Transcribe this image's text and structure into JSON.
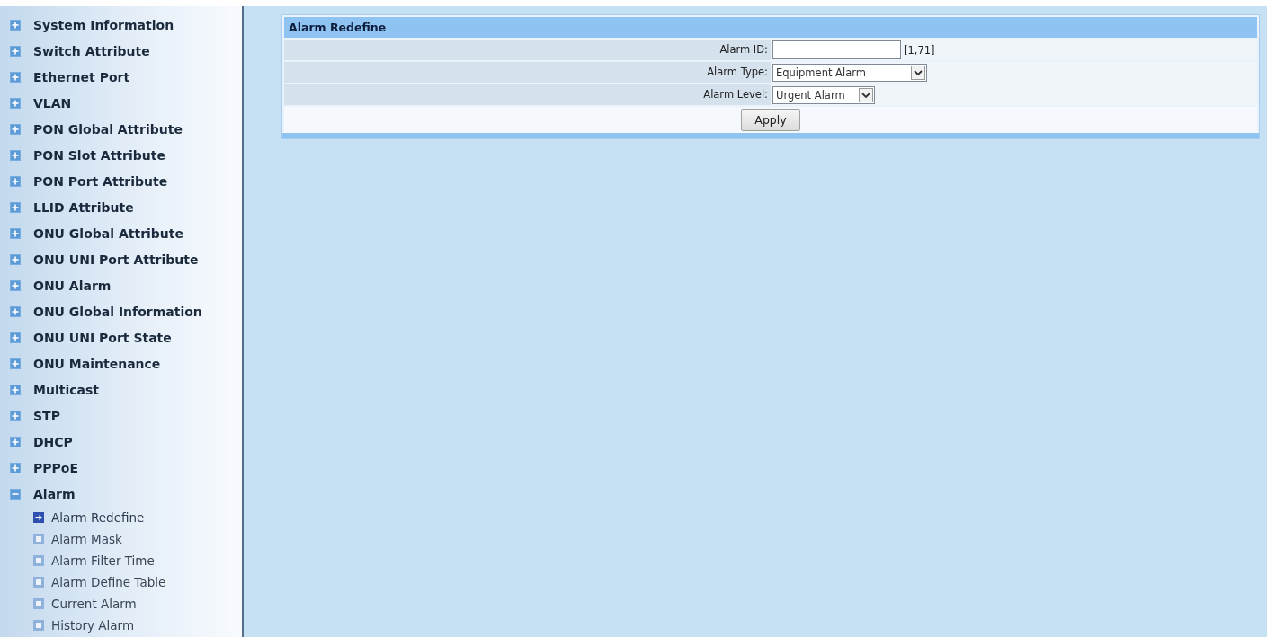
{
  "sidebar": {
    "items": [
      {
        "label": "System Information",
        "expanded": false
      },
      {
        "label": "Switch Attribute",
        "expanded": false
      },
      {
        "label": "Ethernet Port",
        "expanded": false
      },
      {
        "label": "VLAN",
        "expanded": false
      },
      {
        "label": "PON Global Attribute",
        "expanded": false
      },
      {
        "label": "PON Slot Attribute",
        "expanded": false
      },
      {
        "label": "PON Port Attribute",
        "expanded": false
      },
      {
        "label": "LLID Attribute",
        "expanded": false
      },
      {
        "label": "ONU Global Attribute",
        "expanded": false
      },
      {
        "label": "ONU UNI Port Attribute",
        "expanded": false
      },
      {
        "label": "ONU Alarm",
        "expanded": false
      },
      {
        "label": "ONU Global Information",
        "expanded": false
      },
      {
        "label": "ONU UNI Port State",
        "expanded": false
      },
      {
        "label": "ONU Maintenance",
        "expanded": false
      },
      {
        "label": "Multicast",
        "expanded": false
      },
      {
        "label": "STP",
        "expanded": false
      },
      {
        "label": "DHCP",
        "expanded": false
      },
      {
        "label": "PPPoE",
        "expanded": false
      },
      {
        "label": "Alarm",
        "expanded": true,
        "children": [
          {
            "label": "Alarm Redefine",
            "selected": true
          },
          {
            "label": "Alarm Mask",
            "selected": false
          },
          {
            "label": "Alarm Filter Time",
            "selected": false
          },
          {
            "label": "Alarm Define Table",
            "selected": false
          },
          {
            "label": "Current Alarm",
            "selected": false
          },
          {
            "label": "History Alarm",
            "selected": false
          }
        ]
      }
    ]
  },
  "panel": {
    "title": "Alarm Redefine",
    "fields": [
      {
        "kind": "input",
        "label": "Alarm ID:",
        "hint": "[1,71]"
      },
      {
        "kind": "select",
        "label": "Alarm Type:",
        "value": "Equipment Alarm"
      },
      {
        "kind": "select",
        "label": "Alarm Level:",
        "value": "Urgent Alarm"
      }
    ],
    "button": "Apply"
  }
}
